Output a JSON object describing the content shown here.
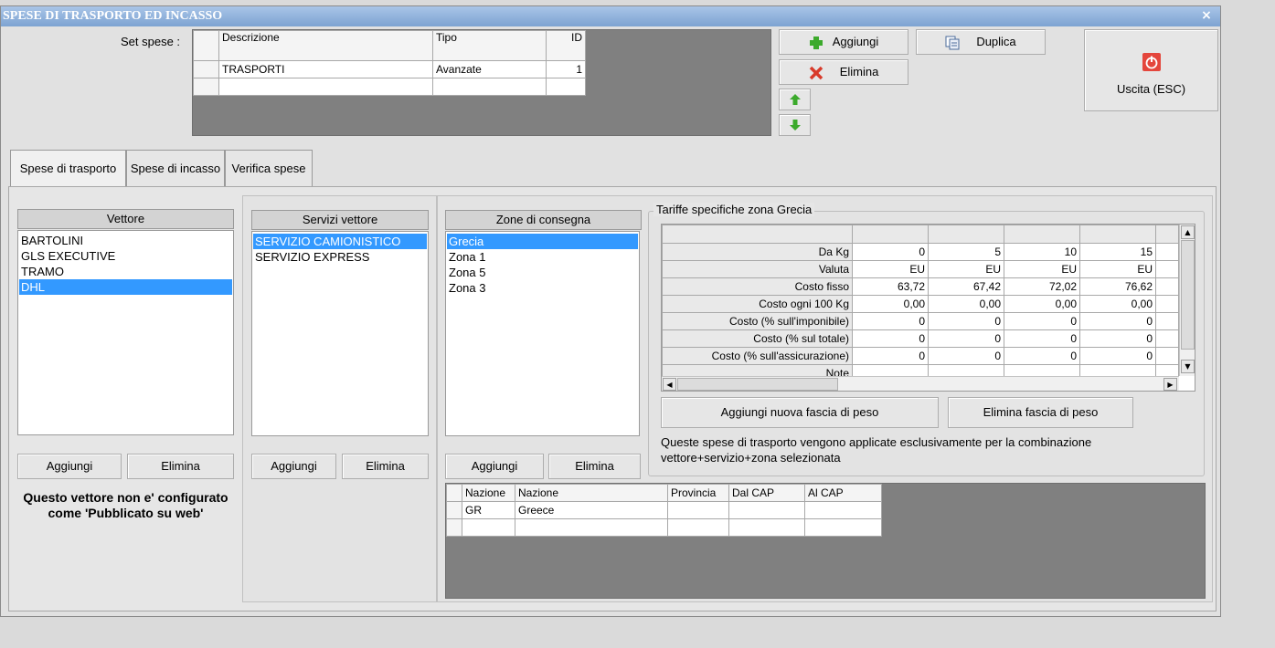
{
  "window": {
    "title": "SPESE DI TRASPORTO ED INCASSO",
    "close_glyph": "×"
  },
  "set_spese": {
    "label": "Set spese :",
    "columns": [
      "Descrizione",
      "Tipo",
      "ID"
    ],
    "rows": [
      {
        "descrizione": "TRASPORTI",
        "tipo": "Avanzate",
        "id": "1"
      }
    ]
  },
  "top_buttons": {
    "aggiungi": "Aggiungi",
    "elimina": "Elimina",
    "duplica": "Duplica",
    "uscita": "Uscita (ESC)"
  },
  "icons": {
    "add": "plus-icon",
    "delete": "x-icon",
    "duplicate": "copy-icon",
    "exit": "power-icon",
    "up": "arrow-up-icon",
    "down": "arrow-down-icon"
  },
  "colors": {
    "selection": "#3399ff",
    "add_green": "#3caa2c",
    "delete_red": "#d83a2a",
    "exit_red": "#e4463c"
  },
  "tabs": [
    "Spese di trasporto",
    "Spese di incasso",
    "Verifica spese"
  ],
  "vettore": {
    "header": "Vettore",
    "items": [
      "BARTOLINI",
      "GLS EXECUTIVE",
      "TRAMO",
      "DHL"
    ],
    "selected": "DHL",
    "add": "Aggiungi",
    "delete": "Elimina",
    "note": "Questo vettore non e' configurato come 'Pubblicato su web'"
  },
  "servizi": {
    "header": "Servizi vettore",
    "items": [
      "SERVIZIO CAMIONISTICO",
      "SERVIZIO EXPRESS"
    ],
    "selected": "SERVIZIO CAMIONISTICO",
    "add": "Aggiungi",
    "delete": "Elimina"
  },
  "zone": {
    "header": "Zone di consegna",
    "items": [
      "Grecia",
      "Zona 1",
      "Zona 5",
      "Zona 3"
    ],
    "selected": "Grecia",
    "add": "Aggiungi",
    "delete": "Elimina",
    "nazioni": {
      "columns": [
        "Nazione",
        "Nazione",
        "Provincia",
        "Dal CAP",
        "Al CAP"
      ],
      "rows": [
        {
          "code": "GR",
          "name": "Greece",
          "provincia": "",
          "dal": "",
          "al": ""
        }
      ]
    }
  },
  "tariffe": {
    "title": "Tariffe specifiche zona Grecia",
    "rows": [
      {
        "label": "Da Kg",
        "values": [
          "0",
          "5",
          "10",
          "15"
        ]
      },
      {
        "label": "Valuta",
        "values": [
          "EU",
          "EU",
          "EU",
          "EU"
        ]
      },
      {
        "label": "Costo fisso",
        "values": [
          "63,72",
          "67,42",
          "72,02",
          "76,62"
        ]
      },
      {
        "label": "Costo ogni 100 Kg",
        "values": [
          "0,00",
          "0,00",
          "0,00",
          "0,00"
        ]
      },
      {
        "label": "Costo (% sull'imponibile)",
        "values": [
          "0",
          "0",
          "0",
          "0"
        ]
      },
      {
        "label": "Costo (% sul totale)",
        "values": [
          "0",
          "0",
          "0",
          "0"
        ]
      },
      {
        "label": "Costo (% sull'assicurazione)",
        "values": [
          "0",
          "0",
          "0",
          "0"
        ]
      },
      {
        "label": "Note",
        "values": [
          "",
          "",
          "",
          ""
        ]
      }
    ],
    "add_band": "Aggiungi nuova fascia di peso",
    "delete_band": "Elimina fascia di peso",
    "info": "Queste spese di trasporto vengono applicate esclusivamente per la combinazione vettore+servizio+zona selezionata"
  }
}
